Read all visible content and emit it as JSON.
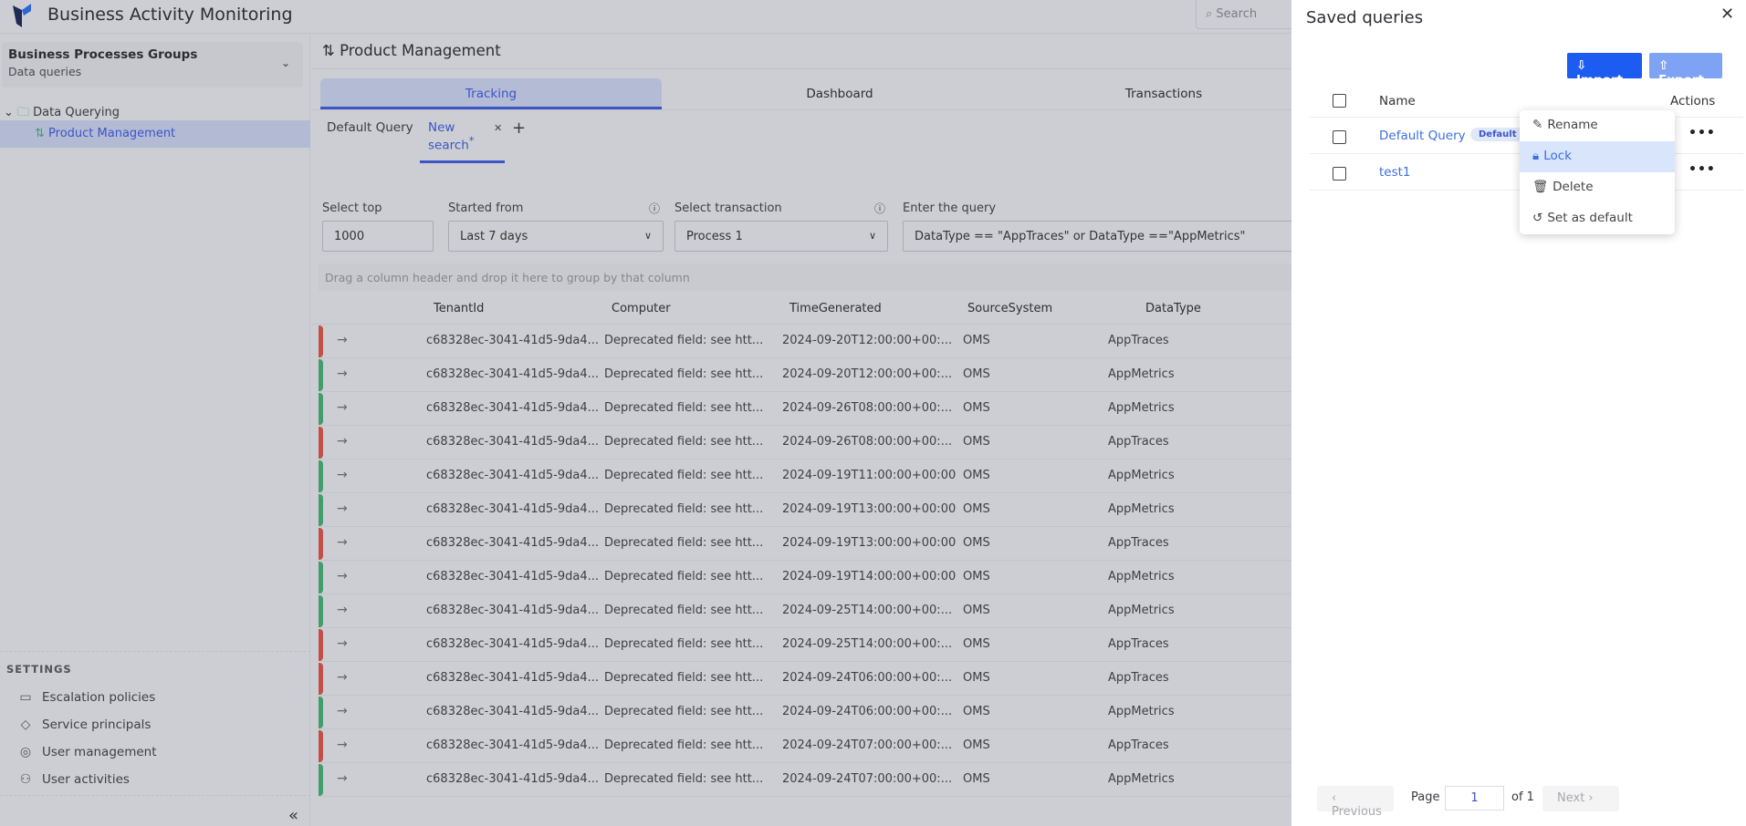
{
  "header": {
    "title": "Business Activity Monitoring",
    "search_placeholder": "Search"
  },
  "sidebar": {
    "group_title": "Business Processes Groups",
    "group_subtitle": "Data queries",
    "tree": {
      "folder": "Data Querying",
      "item": "Product Management"
    },
    "settings_title": "SETTINGS",
    "settings": [
      {
        "label": "Escalation policies",
        "icon": "monitor-icon"
      },
      {
        "label": "Service principals",
        "icon": "diamond-icon"
      },
      {
        "label": "User management",
        "icon": "user-circle-icon"
      },
      {
        "label": "User activities",
        "icon": "user-clock-icon"
      }
    ],
    "collapse": "«"
  },
  "main": {
    "title": "Product Management",
    "tabs": [
      "Tracking",
      "Dashboard",
      "Transactions"
    ],
    "query_tabs": [
      "Default Query",
      "New search"
    ],
    "query_tab_modified": "*",
    "filters": {
      "select_top_label": "Select top",
      "select_top": "1000",
      "started_from_label": "Started from",
      "started_from": "Last 7 days",
      "transaction_label": "Select transaction",
      "transaction": "Process 1",
      "query_label": "Enter the query",
      "query": "DataType == \"AppTraces\" or DataType ==\"AppMetrics\""
    },
    "group_hint": "Drag a column header and drop it here to group by that column",
    "columns": [
      "TenantId",
      "Computer",
      "TimeGenerated",
      "SourceSystem",
      "DataType"
    ],
    "status_colors": {
      "error": "#c0504a",
      "ok": "#3f9e6a"
    },
    "rows": [
      {
        "status": "error",
        "tenant": "c68328ec-3041-41d5-9da4...",
        "computer": "Deprecated field: see htt...",
        "time": "2024-09-20T12:00:00+00:...",
        "source": "OMS",
        "type": "AppTraces"
      },
      {
        "status": "ok",
        "tenant": "c68328ec-3041-41d5-9da4...",
        "computer": "Deprecated field: see htt...",
        "time": "2024-09-20T12:00:00+00:...",
        "source": "OMS",
        "type": "AppMetrics"
      },
      {
        "status": "ok",
        "tenant": "c68328ec-3041-41d5-9da4...",
        "computer": "Deprecated field: see htt...",
        "time": "2024-09-26T08:00:00+00:...",
        "source": "OMS",
        "type": "AppMetrics"
      },
      {
        "status": "error",
        "tenant": "c68328ec-3041-41d5-9da4...",
        "computer": "Deprecated field: see htt...",
        "time": "2024-09-26T08:00:00+00:...",
        "source": "OMS",
        "type": "AppTraces"
      },
      {
        "status": "ok",
        "tenant": "c68328ec-3041-41d5-9da4...",
        "computer": "Deprecated field: see htt...",
        "time": "2024-09-19T11:00:00+00:00",
        "source": "OMS",
        "type": "AppMetrics"
      },
      {
        "status": "ok",
        "tenant": "c68328ec-3041-41d5-9da4...",
        "computer": "Deprecated field: see htt...",
        "time": "2024-09-19T13:00:00+00:00",
        "source": "OMS",
        "type": "AppMetrics"
      },
      {
        "status": "error",
        "tenant": "c68328ec-3041-41d5-9da4...",
        "computer": "Deprecated field: see htt...",
        "time": "2024-09-19T13:00:00+00:00",
        "source": "OMS",
        "type": "AppTraces"
      },
      {
        "status": "ok",
        "tenant": "c68328ec-3041-41d5-9da4...",
        "computer": "Deprecated field: see htt...",
        "time": "2024-09-19T14:00:00+00:00",
        "source": "OMS",
        "type": "AppMetrics"
      },
      {
        "status": "ok",
        "tenant": "c68328ec-3041-41d5-9da4...",
        "computer": "Deprecated field: see htt...",
        "time": "2024-09-25T14:00:00+00:...",
        "source": "OMS",
        "type": "AppMetrics"
      },
      {
        "status": "error",
        "tenant": "c68328ec-3041-41d5-9da4...",
        "computer": "Deprecated field: see htt...",
        "time": "2024-09-25T14:00:00+00:...",
        "source": "OMS",
        "type": "AppTraces"
      },
      {
        "status": "error",
        "tenant": "c68328ec-3041-41d5-9da4...",
        "computer": "Deprecated field: see htt...",
        "time": "2024-09-24T06:00:00+00:...",
        "source": "OMS",
        "type": "AppTraces"
      },
      {
        "status": "ok",
        "tenant": "c68328ec-3041-41d5-9da4...",
        "computer": "Deprecated field: see htt...",
        "time": "2024-09-24T06:00:00+00:...",
        "source": "OMS",
        "type": "AppMetrics"
      },
      {
        "status": "error",
        "tenant": "c68328ec-3041-41d5-9da4...",
        "computer": "Deprecated field: see htt...",
        "time": "2024-09-24T07:00:00+00:...",
        "source": "OMS",
        "type": "AppTraces"
      },
      {
        "status": "ok",
        "tenant": "c68328ec-3041-41d5-9da4...",
        "computer": "Deprecated field: see htt...",
        "time": "2024-09-24T07:00:00+00:...",
        "source": "OMS",
        "type": "AppMetrics"
      }
    ]
  },
  "panel": {
    "title": "Saved queries",
    "import": "Import",
    "export": "Export",
    "col_name": "Name",
    "col_actions": "Actions",
    "queries": [
      {
        "name": "Default Query",
        "badge": "Default"
      },
      {
        "name": "test1"
      }
    ],
    "menu": [
      "Rename",
      "Lock",
      "Delete",
      "Set as default"
    ],
    "pager": {
      "previous": "Previous",
      "page_label": "Page",
      "page": "1",
      "of": "of 1",
      "next": "Next"
    }
  }
}
